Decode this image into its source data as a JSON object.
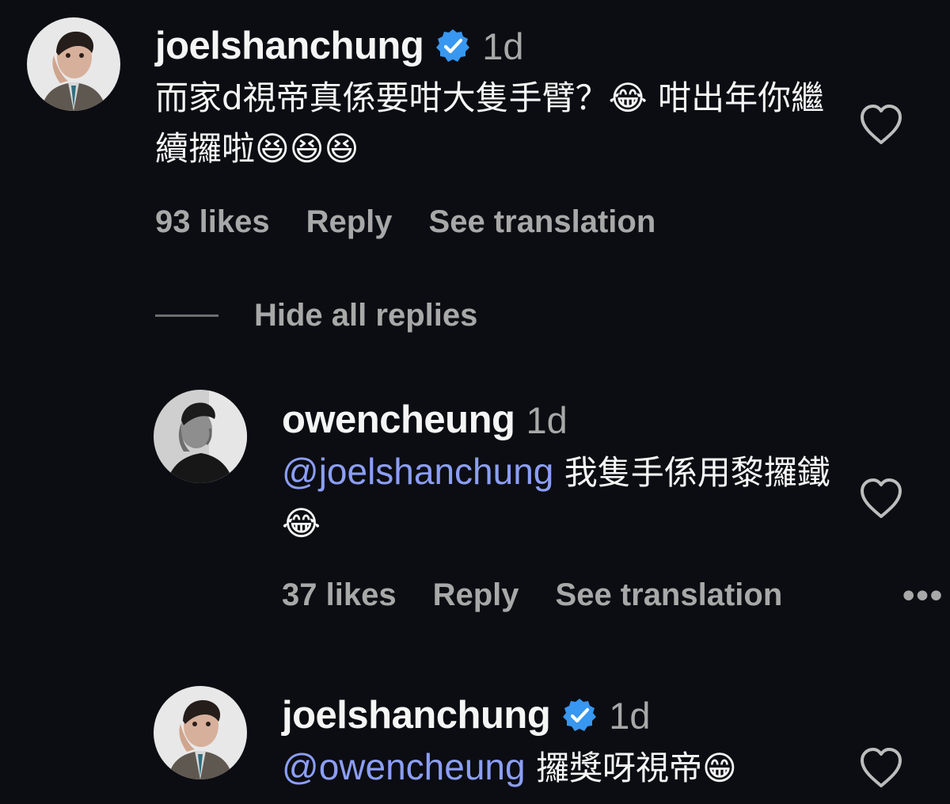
{
  "comments": [
    {
      "username": "joelshanchung",
      "verified": true,
      "time": "1d",
      "text": "而家d視帝真係要咁大隻手臂？😂 咁出年你繼續攞啦😆😆😆",
      "likes": "93 likes",
      "reply": "Reply",
      "translate": "See translation"
    },
    {
      "username": "owencheung",
      "verified": false,
      "time": "1d",
      "mention": "@joelshanchung",
      "text": " 我隻手係用黎攞鐵😂",
      "likes": "37 likes",
      "reply": "Reply",
      "translate": "See translation"
    },
    {
      "username": "joelshanchung",
      "verified": true,
      "time": "1d",
      "mention": "@owencheung",
      "text": " 攞獎呀視帝😁"
    }
  ],
  "thread": {
    "hide_replies": "Hide all replies",
    "more": "•••"
  },
  "colors": {
    "background": "#0c0d12",
    "text": "#f5f5f5",
    "muted": "#a8a8a8",
    "mention": "#8c9ef7",
    "verified": "#3897f0"
  },
  "icons": [
    "verified-badge-icon",
    "heart-icon",
    "more-icon"
  ]
}
